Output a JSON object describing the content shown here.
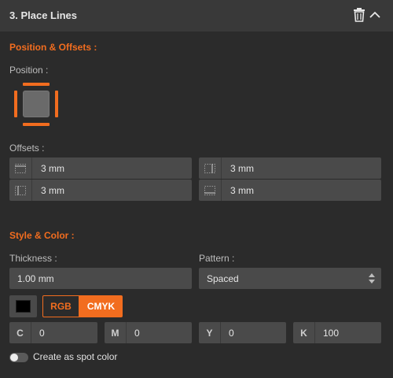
{
  "header": {
    "title": "3.  Place Lines"
  },
  "position_section": {
    "title": "Position & Offsets :",
    "position_label": "Position :",
    "offsets_label": "Offsets :",
    "offsets": [
      {
        "value": "3 mm",
        "icon": "offset-top-icon"
      },
      {
        "value": "3 mm",
        "icon": "offset-right-icon"
      },
      {
        "value": "3 mm",
        "icon": "offset-left-icon"
      },
      {
        "value": "3 mm",
        "icon": "offset-bottom-icon"
      }
    ]
  },
  "style_section": {
    "title": "Style & Color :",
    "thickness_label": "Thickness :",
    "thickness_value": "1.00 mm",
    "pattern_label": "Pattern :",
    "pattern_value": "Spaced",
    "swatch_color": "#000000",
    "color_modes": {
      "rgb": "RGB",
      "cmyk": "CMYK",
      "active": "CMYK"
    },
    "cmyk": [
      {
        "letter": "C",
        "value": "0"
      },
      {
        "letter": "M",
        "value": "0"
      },
      {
        "letter": "Y",
        "value": "0"
      },
      {
        "letter": "K",
        "value": "100"
      }
    ],
    "spot_color_label": "Create as spot color",
    "spot_color_enabled": false
  },
  "colors": {
    "accent": "#f26d1f",
    "panel": "#2b2b2b",
    "header": "#393939",
    "field": "#4a4a4a"
  }
}
